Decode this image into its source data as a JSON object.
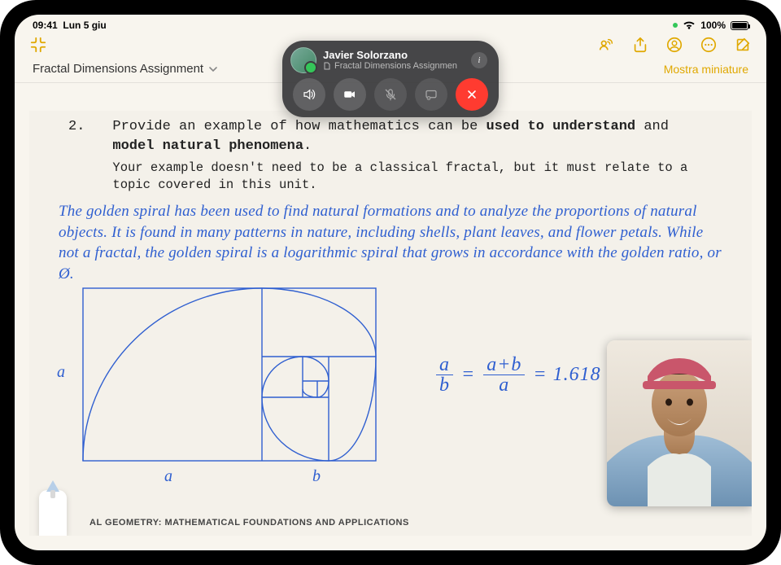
{
  "status": {
    "time": "09:41",
    "date": "Lun 5 giu",
    "battery_pct": "100%"
  },
  "toolbar": {
    "show_thumbnails": "Mostra miniature"
  },
  "document": {
    "title": "Fractal Dimensions Assignment",
    "question_number": "2.",
    "question_line1": "Provide an example of how mathematics can be ",
    "question_bold1": "used to understand",
    "question_mid": " and ",
    "question_bold2": "model natural phenomena",
    "question_end": ".",
    "question_sub": "Your example doesn't need to be a classical fractal, but it must relate to a topic covered in this unit.",
    "handwriting": "The golden spiral has been used to find natural formations and to analyze the proportions of natural objects. It is found in many patterns in nature, including shells, plant leaves, and flower petals. While not a fractal, the golden spiral is a logarithmic spiral that grows in accordance with the golden ratio, or Ø.",
    "label_a_left": "a",
    "label_a_bottom": "a",
    "label_b_bottom": "b",
    "eq_frac1_top": "a",
    "eq_frac1_bot": "b",
    "eq_eq1": "=",
    "eq_frac2_top": "a+b",
    "eq_frac2_bot": "a",
    "eq_eq2": "= 1.618",
    "footer": "AL GEOMETRY: MATHEMATICAL FOUNDATIONS AND APPLICATIONS"
  },
  "facetime": {
    "name": "Javier Solorzano",
    "sharing_label": "Fractal Dimensions Assignmen"
  }
}
